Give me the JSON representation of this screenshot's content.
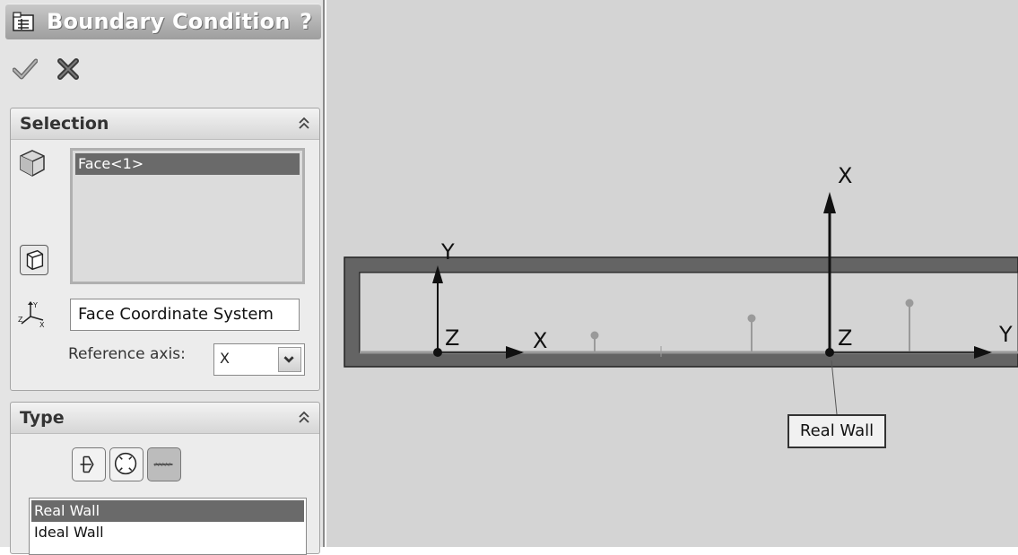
{
  "panel": {
    "title": "Boundary Condition",
    "help": "?",
    "ok_icon": "checkmark-icon",
    "cancel_icon": "x-icon"
  },
  "selection": {
    "header": "Selection",
    "faces": [
      "Face<1>"
    ],
    "coordinate_system": "Face Coordinate System",
    "reference_axis_label": "Reference axis:",
    "reference_axis_value": "X"
  },
  "type": {
    "header": "Type",
    "buttons": [
      "inlet-outlet-icon",
      "pressure-opening-icon",
      "wall-icon"
    ],
    "options": [
      "Real Wall",
      "Ideal Wall"
    ],
    "selected": "Real Wall"
  },
  "viewport": {
    "triad1": {
      "y": "Y",
      "z": "Z",
      "x": "X"
    },
    "triad2": {
      "x": "X",
      "z": "Z",
      "y": "Y"
    },
    "callout": "Real Wall"
  },
  "colors": {
    "panel_bg": "#e4e4e4",
    "selected_bg": "#6a6a6a",
    "viewport_bg": "#d4d4d4",
    "solid_edge": "#646464"
  }
}
